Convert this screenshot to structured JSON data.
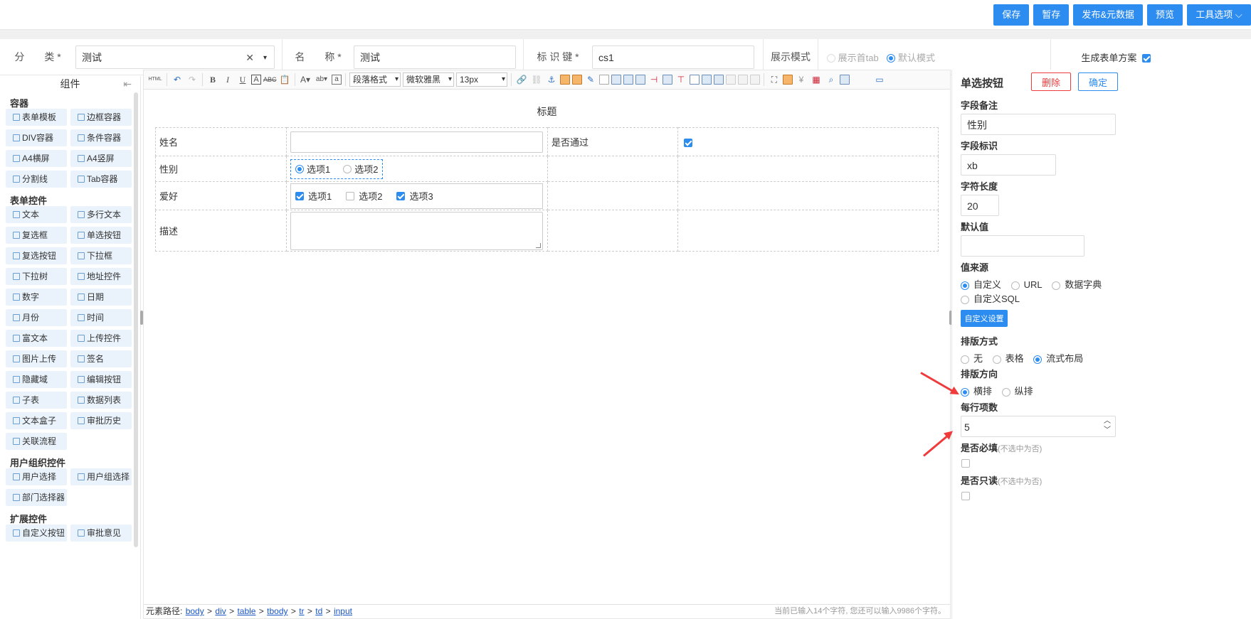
{
  "topbar": {
    "buttons": [
      "保存",
      "暂存",
      "发布&元数据",
      "预览",
      "工具选项 ⌵"
    ]
  },
  "meta": {
    "category_label": "分　　类 *",
    "category_value": "测试",
    "name_label": "名　　称 *",
    "name_value": "测试",
    "key_label": "标 识 键 *",
    "key_value": "cs1",
    "display_mode_label": "展示模式",
    "display_opt1": "展示首tab",
    "display_opt2": "默认模式",
    "gen_scheme_label": "生成表单方案"
  },
  "left": {
    "title": "组件",
    "groups": [
      {
        "title": "容器",
        "items": [
          "表单模板",
          "边框容器",
          "DIV容器",
          "条件容器",
          "A4横屏",
          "A4竖屏",
          "分割线",
          "Tab容器"
        ]
      },
      {
        "title": "表单控件",
        "items": [
          "文本",
          "多行文本",
          "复选框",
          "单选按钮",
          "复选按钮",
          "下拉框",
          "下拉树",
          "地址控件",
          "数字",
          "日期",
          "月份",
          "时间",
          "富文本",
          "上传控件",
          "图片上传",
          "签名",
          "隐藏域",
          "编辑按钮",
          "子表",
          "数据列表",
          "文本盒子",
          "审批历史",
          "关联流程"
        ]
      },
      {
        "title": "用户组织控件",
        "items": [
          "用户选择",
          "用户组选择",
          "部门选择器"
        ]
      },
      {
        "title": "扩展控件",
        "items": [
          "自定义按钮",
          "审批意见"
        ]
      }
    ]
  },
  "toolbar": {
    "html_label": "HTML",
    "para_format": "段落格式",
    "font_family": "微软雅黑",
    "font_size": "13px"
  },
  "form": {
    "title": "标题",
    "rows": [
      {
        "label": "姓名",
        "label2": "是否通过"
      },
      {
        "label": "性别",
        "options": [
          "选项1",
          "选项2"
        ]
      },
      {
        "label": "爱好",
        "options": [
          "选项1",
          "选项2",
          "选项3"
        ]
      },
      {
        "label": "描述"
      }
    ]
  },
  "statusbar": {
    "path_label": "元素路径:",
    "path": [
      "body",
      "div",
      "table",
      "tbody",
      "tr",
      "td",
      "input"
    ],
    "count_text": "当前已输入14个字符, 您还可以输入9986个字符。"
  },
  "right": {
    "title": "单选按钮",
    "delete_label": "删除",
    "confirm_label": "确定",
    "field_note_label": "字段备注",
    "field_note_value": "性别",
    "field_key_label": "字段标识",
    "field_key_value": "xb",
    "char_len_label": "字符长度",
    "char_len_value": "20",
    "default_label": "默认值",
    "default_value": "",
    "source_label": "值来源",
    "source_options": [
      "自定义",
      "URL",
      "数据字典",
      "自定义SQL"
    ],
    "custom_btn": "自定义设置",
    "layout_label": "排版方式",
    "layout_options": [
      "无",
      "表格",
      "流式布局"
    ],
    "direction_label": "排版方向",
    "direction_options": [
      "横排",
      "纵排"
    ],
    "per_row_label": "每行项数",
    "per_row_value": "5",
    "required_label": "是否必填",
    "required_hint": "(不选中为否)",
    "readonly_label": "是否只读",
    "readonly_hint": "(不选中为否)"
  },
  "colors": {
    "accent": "#2d8cf0",
    "danger": "#ef3b3b",
    "comp_bg": "#eaf3fc"
  }
}
